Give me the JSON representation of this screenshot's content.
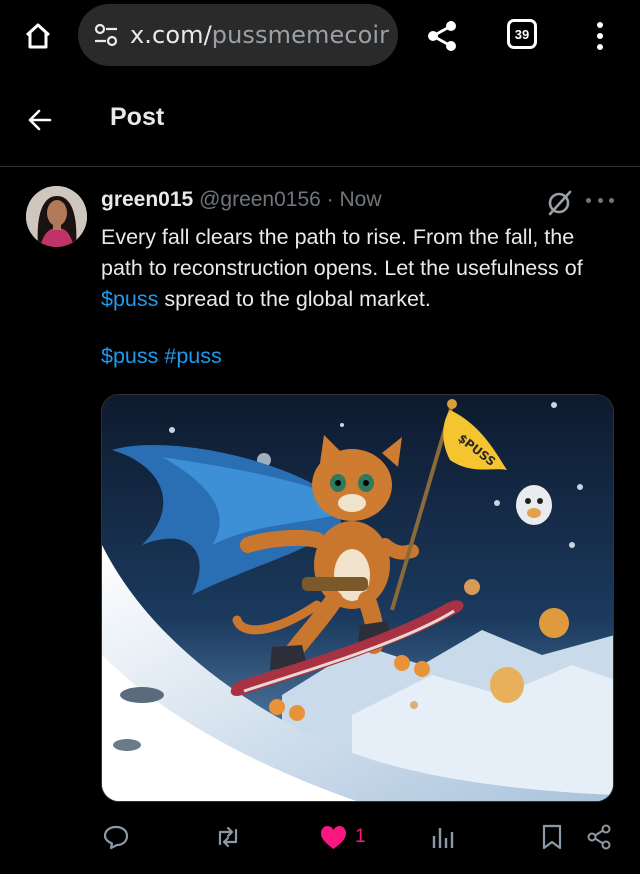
{
  "browser": {
    "url_host": "x.com/",
    "url_path": "pussmemecoir",
    "tab_count": "39"
  },
  "header": {
    "title": "Post"
  },
  "post": {
    "display_name": "green015",
    "handle": "@green0156",
    "separator": "·",
    "time": "Now",
    "text_part1": "Every fall clears the path to rise. From the fall, the path to reconstruction opens. Let the usefulness of ",
    "text_link": "$puss",
    "text_part2": " spread to the global market.",
    "hashtag_1": "$puss",
    "hashtag_2": "#puss",
    "flag_text": "$PUSS",
    "like_count": "1"
  },
  "colors": {
    "accent": "#1d9bf0",
    "like": "#f91880",
    "secondary_text": "#71767b"
  },
  "icons": [
    "home-icon",
    "tune-icon",
    "share-icon",
    "tabs-counter-icon",
    "more-vert-icon",
    "back-arrow-icon",
    "grok-icon",
    "more-horiz-icon",
    "reply-icon",
    "repost-icon",
    "heart-icon",
    "views-icon",
    "bookmark-icon",
    "share-post-icon"
  ]
}
